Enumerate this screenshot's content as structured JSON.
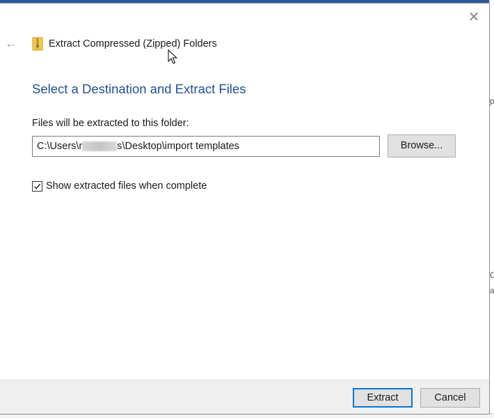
{
  "window": {
    "title": "Extract Compressed (Zipped) Folders",
    "close_symbol": "✕",
    "back_symbol": "←",
    "icon": "zip-folder-icon"
  },
  "main": {
    "heading": "Select a Destination and Extract Files",
    "field_label": "Files will be extracted to this folder:",
    "path_prefix": "C:\\Users\\r",
    "path_suffix": "s\\Desktop\\import templates",
    "browse_label": "Browse...",
    "checkbox_label": "Show extracted files when complete",
    "checkbox_checked": true
  },
  "footer": {
    "extract_label": "Extract",
    "cancel_label": "Cancel"
  },
  "background": {
    "glyphs": [
      "p",
      "C",
      "a"
    ]
  },
  "colors": {
    "heading": "#1e4e9c",
    "focus_border": "#0078d7",
    "button_bg": "#e1e1e1",
    "footer_bg": "#f0f0f0"
  }
}
